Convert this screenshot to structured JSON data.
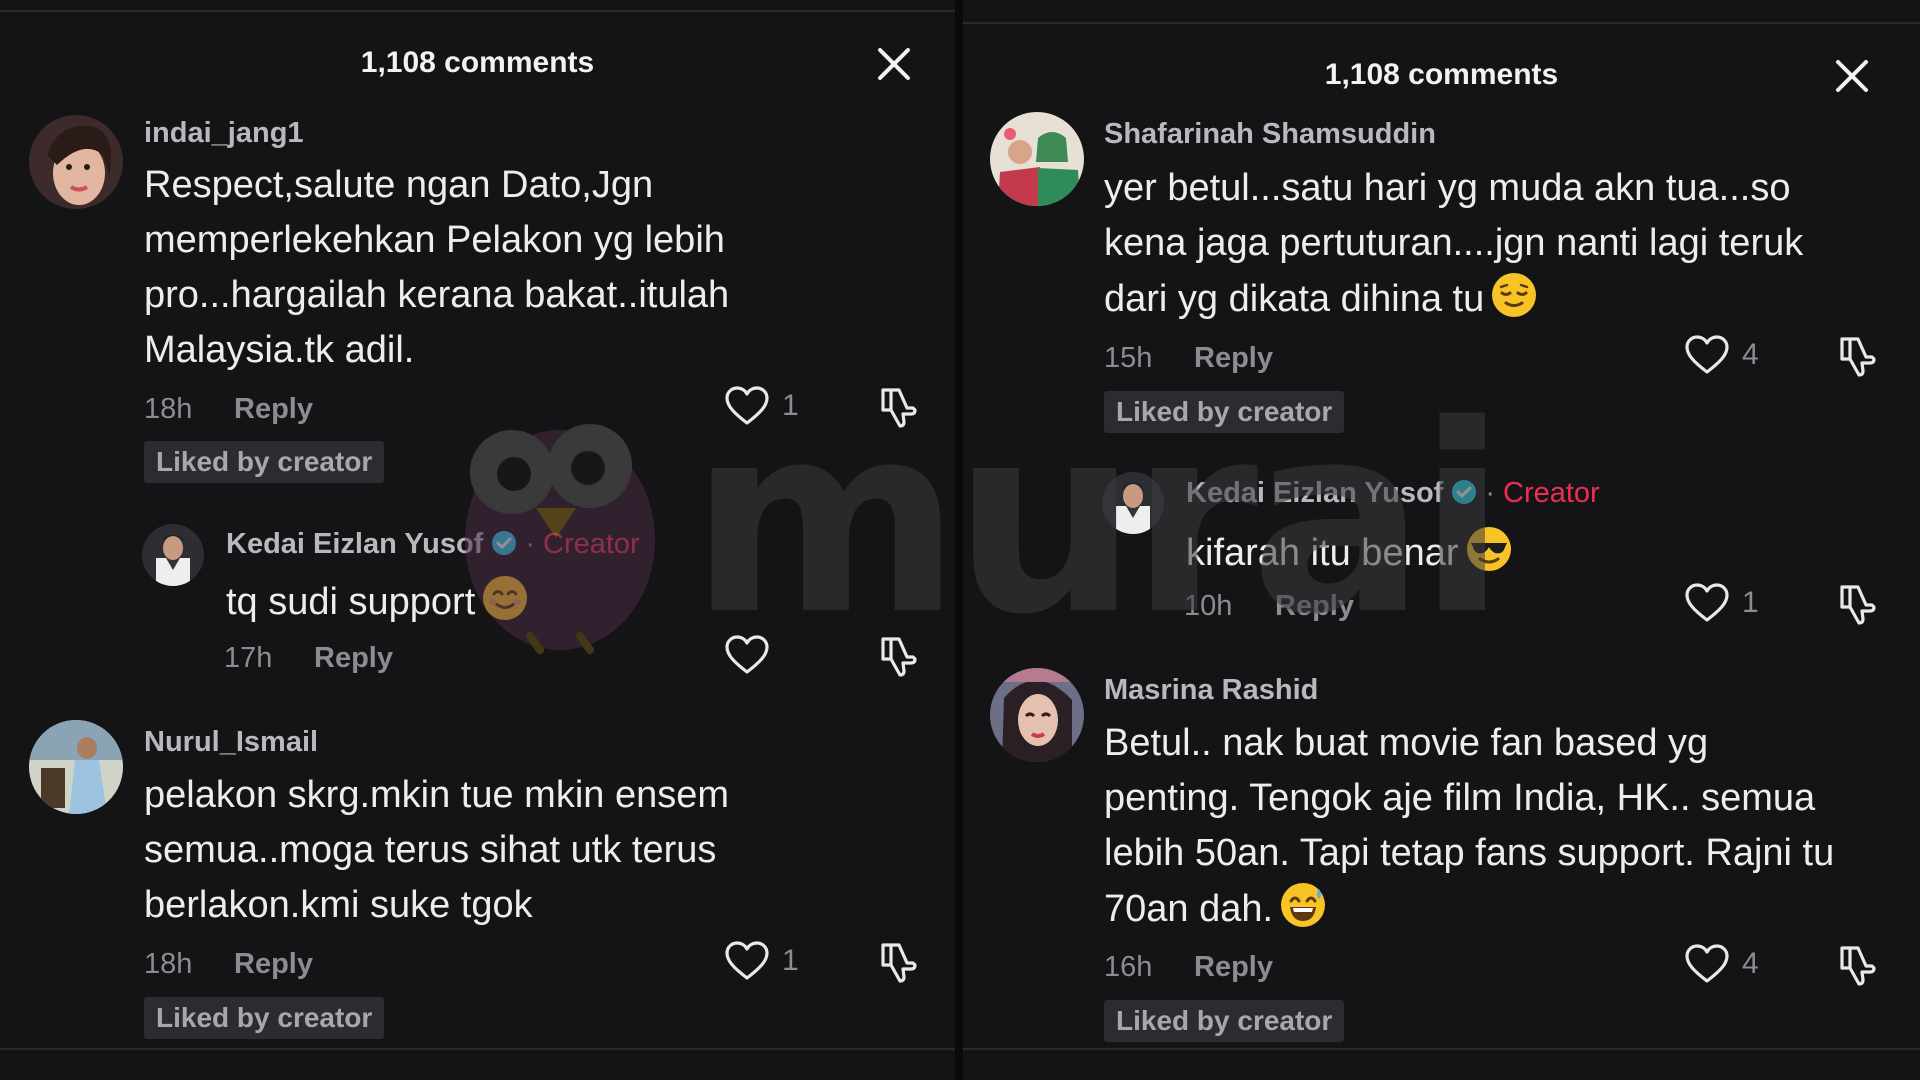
{
  "left_panel": {
    "title": "1,108 comments",
    "comments": [
      {
        "username": "indai_jang1",
        "text_lines": [
          "Respect,salute ngan Dato,Jgn",
          "memperlekehkan Pelakon yg lebih",
          "pro...hargailah kerana bakat..itulah",
          "Malaysia.tk adil."
        ],
        "time": "18h",
        "reply_label": "Reply",
        "likes": "1",
        "badge": "Liked by creator",
        "avatar_color": "#d8a48f"
      },
      {
        "username": "Kedai Eizlan Yusof",
        "dot": "·",
        "creator_label": "Creator",
        "text": "tq sudi support",
        "emoji": "smiling-face-emoji",
        "time": "17h",
        "reply_label": "Reply",
        "likes": "",
        "avatar_color": "#6a6a70"
      },
      {
        "username": "Nurul_Ismail",
        "text_lines": [
          "pelakon skrg.mkin tue mkin ensem",
          "semua..moga terus sihat utk terus",
          "berlakon.kmi suke tgok"
        ],
        "time": "18h",
        "reply_label": "Reply",
        "likes": "1",
        "badge": "Liked by creator",
        "avatar_color": "#8fa7b8"
      }
    ]
  },
  "right_panel": {
    "title": "1,108 comments",
    "comments": [
      {
        "username": "Shafarinah Shamsuddin",
        "text_lines": [
          "yer betul...satu hari yg muda akn tua...so",
          "kena jaga pertuturan....jgn nanti lagi teruk",
          "dari yg dikata dihina tu"
        ],
        "emoji": "relieved-face-emoji",
        "time": "15h",
        "reply_label": "Reply",
        "likes": "4",
        "badge": "Liked by creator",
        "avatar_color": "#c46a6a"
      },
      {
        "username": "Kedai Eizlan Yusof",
        "dot": "·",
        "creator_label": "Creator",
        "text": "kifarah itu benar",
        "emoji": "sunglasses-face-emoji",
        "time": "10h",
        "reply_label": "Reply",
        "likes": "1",
        "avatar_color": "#6a6a70"
      },
      {
        "username": "Masrina Rashid",
        "text_lines": [
          "Betul.. nak buat movie fan based yg",
          "penting. Tengok aje film India, HK.. semua",
          "lebih 50an. Tapi tetap fans support. Rajni tu",
          "70an dah."
        ],
        "emoji": "grinning-sweat-emoji",
        "time": "16h",
        "reply_label": "Reply",
        "likes": "4",
        "badge": "Liked by creator",
        "avatar_color": "#b07b8a"
      }
    ]
  },
  "watermark": {
    "text": "murai"
  },
  "colors": {
    "background": "#141416",
    "creator": "#ee2d55",
    "verified": "#20d5ec",
    "muted": "#8c8c91"
  }
}
